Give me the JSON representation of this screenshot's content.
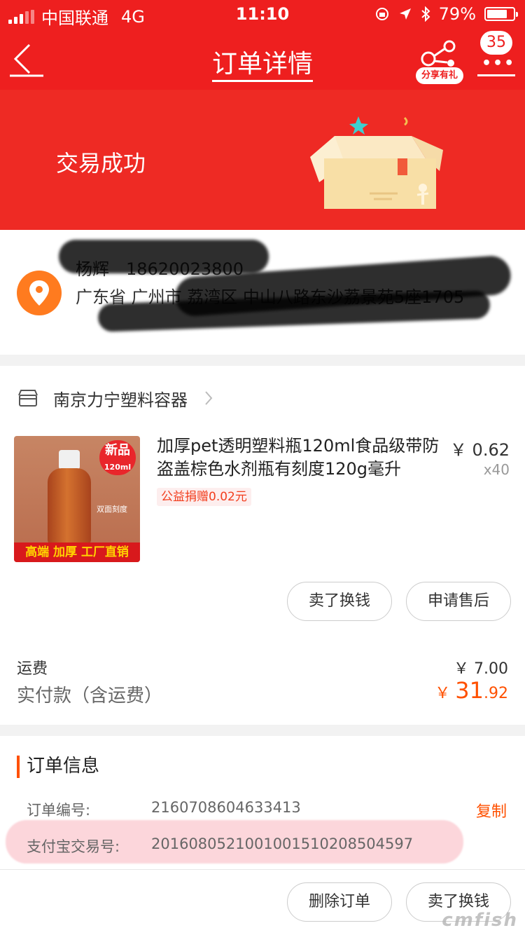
{
  "status_bar": {
    "carrier": "中国联通",
    "network": "4G",
    "time": "11:10",
    "battery": "79%",
    "battery_level": 0.79
  },
  "navbar": {
    "title": "订单详情",
    "share_label": "分享有礼",
    "message_count": "35",
    "dots": "•••"
  },
  "hero": {
    "status_text": "交易成功"
  },
  "address": {
    "name": "杨辉",
    "phone": "18620023800",
    "line": "广东省 广州市 荔湾区 中山八路东沙荔景苑5座1705"
  },
  "shop": {
    "name": "南京力宁塑料容器"
  },
  "product": {
    "thumb_badge": "新品",
    "thumb_badge_sub": "120ml",
    "thumb_label": "双面刻度",
    "thumb_banner": "高端 加厚 工厂直销",
    "title": "加厚pet透明塑料瓶120ml食品级带防盗盖棕色水剂瓶有刻度120g毫升",
    "charity": "公益捐赠0.02元",
    "price": "￥ 0.62",
    "quantity": "x40"
  },
  "actions": {
    "sell": "卖了换钱",
    "after_sale": "申请售后",
    "delete_order": "删除订单",
    "sell_bottom": "卖了换钱"
  },
  "summary": {
    "shipping_label": "运费",
    "shipping_value": "￥ 7.00",
    "total_label": "实付款（含运费）",
    "total_currency": "￥ ",
    "total_int": "31",
    "total_dec": ".92"
  },
  "order_info": {
    "heading": "订单信息",
    "order_no_label": "订单编号:",
    "order_no": "2160708604633413",
    "copy": "复制",
    "alipay_label": "支付宝交易号:",
    "alipay_no": "2016080521001001510208504597"
  },
  "watermark": "cmfish",
  "colors": {
    "brand_red": "#ee1f1f",
    "accent_orange": "#ff5000"
  }
}
